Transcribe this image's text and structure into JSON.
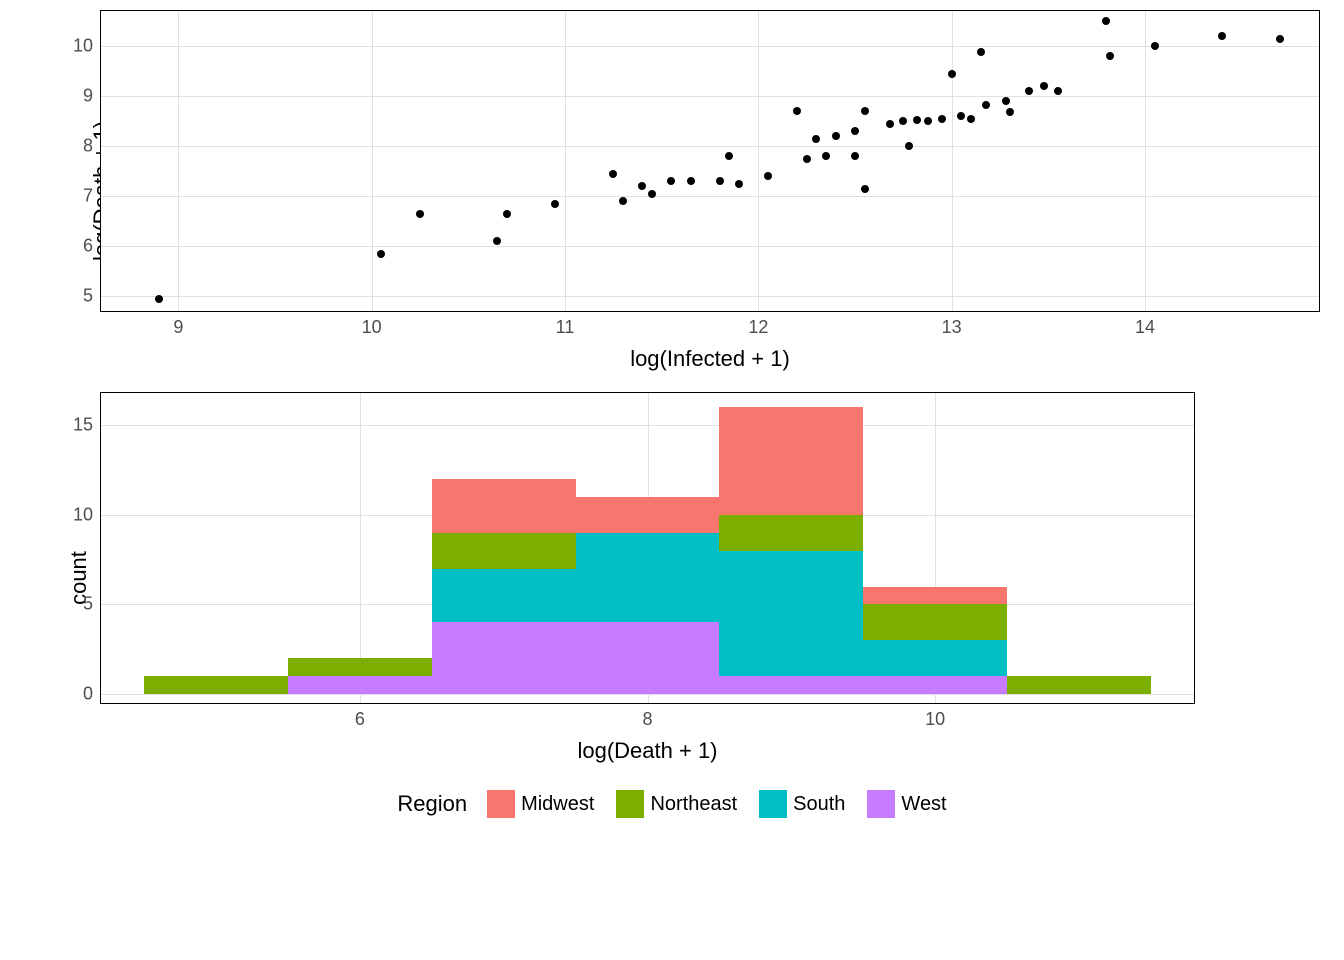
{
  "chart_data": [
    {
      "type": "scatter",
      "xlabel": "log(Infected + 1)",
      "ylabel": "log(Death + 1)",
      "xlim": [
        8.6,
        14.9
      ],
      "ylim": [
        4.7,
        10.7
      ],
      "xticks": [
        9,
        10,
        11,
        12,
        13,
        14
      ],
      "yticks": [
        5,
        6,
        7,
        8,
        9,
        10
      ],
      "points": [
        {
          "x": 8.9,
          "y": 4.95
        },
        {
          "x": 10.05,
          "y": 5.85
        },
        {
          "x": 10.25,
          "y": 6.65
        },
        {
          "x": 10.65,
          "y": 6.1
        },
        {
          "x": 10.7,
          "y": 6.65
        },
        {
          "x": 10.95,
          "y": 6.85
        },
        {
          "x": 11.25,
          "y": 7.45
        },
        {
          "x": 11.3,
          "y": 6.9
        },
        {
          "x": 11.4,
          "y": 7.2
        },
        {
          "x": 11.45,
          "y": 7.05
        },
        {
          "x": 11.55,
          "y": 7.3
        },
        {
          "x": 11.65,
          "y": 7.3
        },
        {
          "x": 11.8,
          "y": 7.3
        },
        {
          "x": 11.85,
          "y": 7.8
        },
        {
          "x": 11.9,
          "y": 7.25
        },
        {
          "x": 12.05,
          "y": 7.4
        },
        {
          "x": 12.2,
          "y": 8.7
        },
        {
          "x": 12.25,
          "y": 7.75
        },
        {
          "x": 12.3,
          "y": 8.15
        },
        {
          "x": 12.35,
          "y": 7.8
        },
        {
          "x": 12.4,
          "y": 8.2
        },
        {
          "x": 12.5,
          "y": 8.3
        },
        {
          "x": 12.5,
          "y": 7.8
        },
        {
          "x": 12.55,
          "y": 7.15
        },
        {
          "x": 12.55,
          "y": 8.7
        },
        {
          "x": 12.68,
          "y": 8.45
        },
        {
          "x": 12.75,
          "y": 8.5
        },
        {
          "x": 12.78,
          "y": 8.0
        },
        {
          "x": 12.82,
          "y": 8.52
        },
        {
          "x": 12.88,
          "y": 8.5
        },
        {
          "x": 12.95,
          "y": 8.55
        },
        {
          "x": 13.0,
          "y": 9.45
        },
        {
          "x": 13.05,
          "y": 8.6
        },
        {
          "x": 13.1,
          "y": 8.55
        },
        {
          "x": 13.15,
          "y": 9.88
        },
        {
          "x": 13.18,
          "y": 8.82
        },
        {
          "x": 13.28,
          "y": 8.9
        },
        {
          "x": 13.3,
          "y": 8.68
        },
        {
          "x": 13.4,
          "y": 9.1
        },
        {
          "x": 13.48,
          "y": 9.2
        },
        {
          "x": 13.55,
          "y": 9.1
        },
        {
          "x": 13.8,
          "y": 10.5
        },
        {
          "x": 13.82,
          "y": 9.8
        },
        {
          "x": 14.05,
          "y": 10.0
        },
        {
          "x": 14.4,
          "y": 10.2
        },
        {
          "x": 14.7,
          "y": 10.15
        }
      ]
    },
    {
      "type": "histogram",
      "xlabel": "log(Death + 1)",
      "ylabel": "count",
      "xlim": [
        4.2,
        11.8
      ],
      "ylim": [
        -0.5,
        16.8
      ],
      "xticks": [
        6,
        8,
        10
      ],
      "yticks": [
        0,
        5,
        10,
        15
      ],
      "bin_width": 1.0,
      "bins": [
        {
          "center": 5.0,
          "stacks": [
            {
              "region": "Northeast",
              "count": 1
            }
          ]
        },
        {
          "center": 6.0,
          "stacks": [
            {
              "region": "West",
              "count": 1
            },
            {
              "region": "Northeast",
              "count": 1
            }
          ]
        },
        {
          "center": 7.0,
          "stacks": [
            {
              "region": "West",
              "count": 4
            },
            {
              "region": "South",
              "count": 3
            },
            {
              "region": "Northeast",
              "count": 2
            },
            {
              "region": "Midwest",
              "count": 3
            }
          ]
        },
        {
          "center": 8.0,
          "stacks": [
            {
              "region": "West",
              "count": 4
            },
            {
              "region": "South",
              "count": 5
            },
            {
              "region": "Midwest",
              "count": 2
            }
          ]
        },
        {
          "center": 9.0,
          "stacks": [
            {
              "region": "West",
              "count": 1
            },
            {
              "region": "South",
              "count": 7
            },
            {
              "region": "Northeast",
              "count": 2
            },
            {
              "region": "Midwest",
              "count": 6
            }
          ]
        },
        {
          "center": 10.0,
          "stacks": [
            {
              "region": "West",
              "count": 1
            },
            {
              "region": "South",
              "count": 2
            },
            {
              "region": "Northeast",
              "count": 2
            },
            {
              "region": "Midwest",
              "count": 1
            }
          ]
        },
        {
          "center": 11.0,
          "stacks": [
            {
              "region": "Northeast",
              "count": 1
            }
          ]
        }
      ],
      "legend_title": "Region",
      "series": [
        {
          "name": "Midwest",
          "color": "#f8766d"
        },
        {
          "name": "Northeast",
          "color": "#7cae00"
        },
        {
          "name": "South",
          "color": "#00bfc4"
        },
        {
          "name": "West",
          "color": "#c77cff"
        }
      ]
    }
  ]
}
